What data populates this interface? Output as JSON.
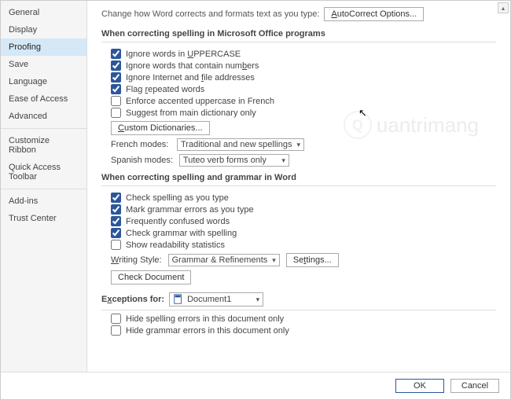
{
  "sidebar": {
    "items": [
      {
        "label": "General"
      },
      {
        "label": "Display"
      },
      {
        "label": "Proofing",
        "selected": true
      },
      {
        "label": "Save"
      },
      {
        "label": "Language"
      },
      {
        "label": "Ease of Access"
      },
      {
        "label": "Advanced"
      },
      {
        "label": "Customize Ribbon"
      },
      {
        "label": "Quick Access Toolbar"
      },
      {
        "label": "Add-ins"
      },
      {
        "label": "Trust Center"
      }
    ]
  },
  "intro": {
    "text": "Change how Word corrects and formats text as you type:",
    "button": "AutoCorrect Options..."
  },
  "section1": {
    "title": "When correcting spelling in Microsoft Office programs",
    "opts": [
      {
        "checked": true,
        "pre": "Ignore words in ",
        "u": "U",
        "post": "PPERCASE"
      },
      {
        "checked": true,
        "pre": "Ignore words that contain num",
        "u": "b",
        "post": "ers"
      },
      {
        "checked": true,
        "pre": "Ignore Internet and ",
        "u": "f",
        "post": "ile addresses"
      },
      {
        "checked": true,
        "pre": "Flag ",
        "u": "r",
        "post": "epeated words"
      },
      {
        "checked": false,
        "pre": "Enforce accented uppercase in French",
        "u": "",
        "post": ""
      },
      {
        "checked": false,
        "pre": "Suggest from main dictionary only",
        "u": "",
        "post": ""
      }
    ],
    "customDict": "Custom Dictionaries...",
    "frenchLabel": "French modes:",
    "frenchValue": "Traditional and new spellings",
    "spanishLabel": "Spanish modes:",
    "spanishValue": "Tuteo verb forms only"
  },
  "section2": {
    "title": "When correcting spelling and grammar in Word",
    "opts": [
      {
        "checked": true,
        "label": "Check spelling as you type"
      },
      {
        "checked": true,
        "label": "Mark grammar errors as you type"
      },
      {
        "checked": true,
        "label": "Frequently confused words"
      },
      {
        "checked": true,
        "label": "Check grammar with spelling"
      },
      {
        "checked": false,
        "label": "Show readability statistics"
      }
    ],
    "writingStyleLabel": "Writing Style:",
    "writingStyleValue": "Grammar & Refinements",
    "settingsBtn": "Settings...",
    "checkDocBtn": "Check Document"
  },
  "exceptions": {
    "label": "Exceptions for:",
    "docValue": "Document1",
    "opts": [
      {
        "checked": false,
        "label": "Hide spelling errors in this document only"
      },
      {
        "checked": false,
        "label": "Hide grammar errors in this document only"
      }
    ]
  },
  "footer": {
    "ok": "OK",
    "cancel": "Cancel"
  },
  "watermark": "uantrimang"
}
